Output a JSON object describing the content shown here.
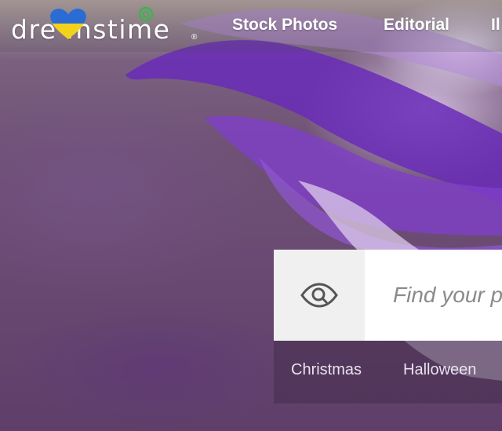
{
  "brand": {
    "logo_text": "dre  mstime",
    "registered_mark": "®",
    "heart_colors": {
      "top": "#2b6cd4",
      "bottom": "#f3d21c"
    },
    "swirl_color": "#3bb54a"
  },
  "nav": {
    "items": [
      {
        "label": "Stock Photos"
      },
      {
        "label": "Editorial"
      },
      {
        "label": "Il"
      }
    ]
  },
  "search": {
    "placeholder": "Find your p",
    "icon": "eye-search-icon"
  },
  "tags": [
    {
      "label": "Christmas"
    },
    {
      "label": "Halloween"
    }
  ]
}
